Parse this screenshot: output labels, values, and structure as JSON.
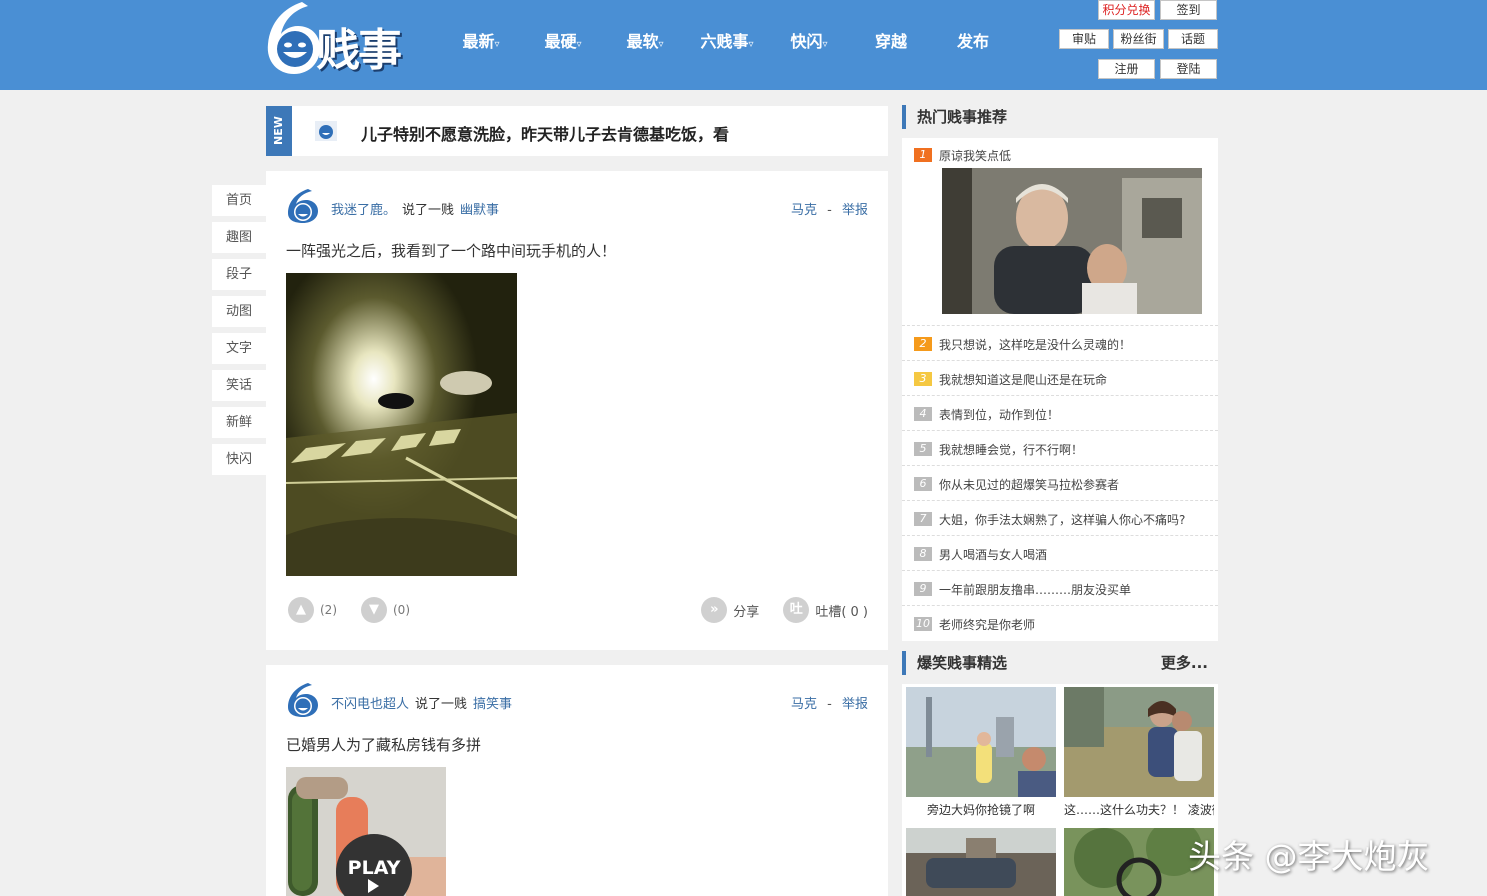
{
  "logo": {
    "text": "贱事"
  },
  "nav": [
    {
      "label": "最新",
      "caret": "▿"
    },
    {
      "label": "最硬",
      "caret": "▿"
    },
    {
      "label": "最软",
      "caret": "▿"
    },
    {
      "label": "六贱事",
      "caret": "▿"
    },
    {
      "label": "快闪",
      "caret": "▿"
    },
    {
      "label": "穿越",
      "caret": ""
    },
    {
      "label": "发布",
      "caret": ""
    }
  ],
  "header_buttons": {
    "points": "积分兑换",
    "checkin": "签到",
    "review": "审贴",
    "fans": "粉丝街",
    "topic": "话题",
    "register": "注册",
    "login": "登陆"
  },
  "left_nav": [
    "首页",
    "趣图",
    "段子",
    "动图",
    "文字",
    "笑话",
    "新鲜",
    "快闪"
  ],
  "notice": {
    "tag": "NEW",
    "text": "儿子特别不愿意洗脸，昨天带儿子去肯德基吃饭，看"
  },
  "posts": [
    {
      "user": "我迷了鹿。",
      "said": "说了一贱",
      "category": "幽默事",
      "mark": "马克",
      "sep": "-",
      "report": "举报",
      "title": "一阵强光之后，我看到了一个路中间玩手机的人！",
      "like_count": "(2)",
      "dislike_count": "(0)",
      "share": "分享",
      "comment_icon": "吐",
      "comment": "吐槽( 0 )"
    },
    {
      "user": "不闪电也超人",
      "said": "说了一贱",
      "category": "搞笑事",
      "mark": "马克",
      "sep": "-",
      "report": "举报",
      "title": "已婚男人为了藏私房钱有多拼",
      "play": "PLAY"
    }
  ],
  "hot": {
    "heading": "热门贱事推荐",
    "items": [
      {
        "rank": "1",
        "text": "原谅我笑点低",
        "color": "#f07020"
      },
      {
        "rank": "2",
        "text": "我只想说，这样吃是没什么灵魂的！",
        "color": "#f59a1b"
      },
      {
        "rank": "3",
        "text": "我就想知道这是爬山还是在玩命",
        "color": "#f5c842"
      },
      {
        "rank": "4",
        "text": "表情到位，动作到位！",
        "color": "#bbbbbb"
      },
      {
        "rank": "5",
        "text": "我就想睡会觉，行不行啊！",
        "color": "#bbbbbb"
      },
      {
        "rank": "6",
        "text": "你从未见过的超爆笑马拉松参赛者",
        "color": "#bbbbbb"
      },
      {
        "rank": "7",
        "text": "大姐，你手法太娴熟了，这样骗人你心不痛吗?",
        "color": "#bbbbbb"
      },
      {
        "rank": "8",
        "text": "男人喝酒与女人喝酒",
        "color": "#bbbbbb"
      },
      {
        "rank": "9",
        "text": "一年前跟朋友撸串………朋友没买单",
        "color": "#bbbbbb"
      },
      {
        "rank": "10",
        "text": "老师终究是你老师",
        "color": "#bbbbbb"
      }
    ]
  },
  "picks": {
    "heading": "爆笑贱事精选",
    "more": "更多...",
    "items": [
      {
        "caption": "旁边大妈你抢镜了啊"
      },
      {
        "caption": "这……这什么功夫？！ 凌波微"
      }
    ]
  },
  "watermark": "头条 @李大炮灰",
  "colors": {
    "header": "#4a8fd4",
    "accent": "#3d78b8",
    "link": "#3a6ea5"
  }
}
